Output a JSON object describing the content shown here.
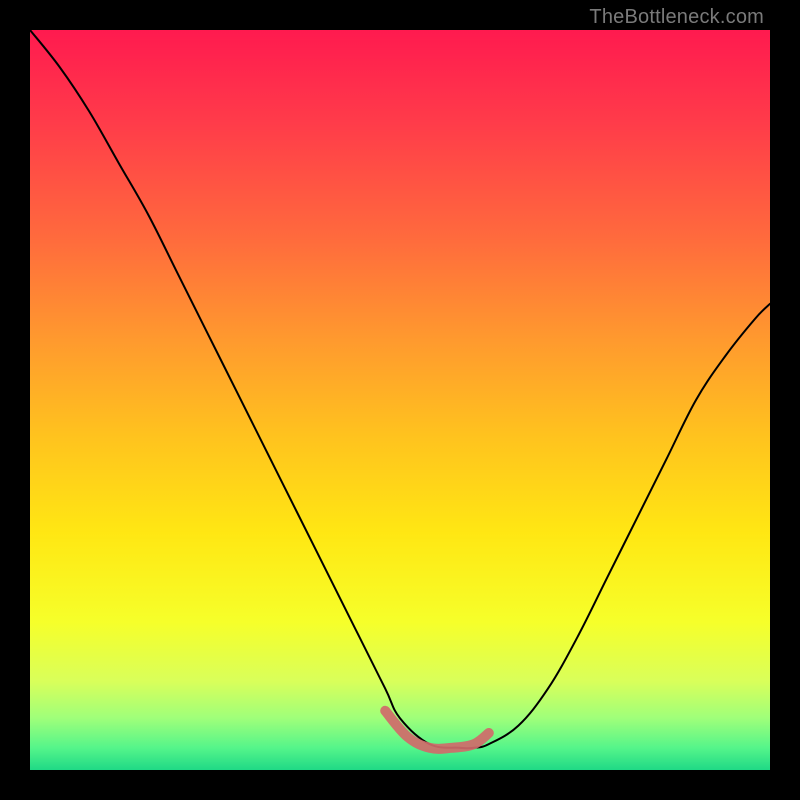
{
  "watermark": "TheBottleneck.com",
  "chart_data": {
    "type": "line",
    "title": "",
    "xlabel": "",
    "ylabel": "",
    "xlim": [
      0,
      100
    ],
    "ylim": [
      0,
      100
    ],
    "grid": false,
    "legend": false,
    "gradient_stops": [
      {
        "pos": 0.0,
        "color": "#ff1a4f"
      },
      {
        "pos": 0.12,
        "color": "#ff3a4a"
      },
      {
        "pos": 0.28,
        "color": "#ff6a3d"
      },
      {
        "pos": 0.42,
        "color": "#ff9a2e"
      },
      {
        "pos": 0.55,
        "color": "#ffc31e"
      },
      {
        "pos": 0.68,
        "color": "#ffe713"
      },
      {
        "pos": 0.8,
        "color": "#f6ff2a"
      },
      {
        "pos": 0.88,
        "color": "#d9ff5a"
      },
      {
        "pos": 0.93,
        "color": "#9fff7a"
      },
      {
        "pos": 0.97,
        "color": "#55f58a"
      },
      {
        "pos": 1.0,
        "color": "#1fd986"
      }
    ],
    "series": [
      {
        "name": "bottleneck-curve",
        "color": "#000000",
        "stroke_width": 2,
        "x": [
          0.0,
          4.0,
          8.0,
          12.0,
          16.0,
          20.0,
          24.0,
          28.0,
          32.0,
          36.0,
          40.0,
          44.0,
          48.0,
          50.0,
          54.0,
          58.0,
          60.0,
          62.0,
          66.0,
          70.0,
          74.0,
          78.0,
          82.0,
          86.0,
          90.0,
          94.0,
          98.0,
          100.0
        ],
        "y": [
          100.0,
          95.0,
          89.0,
          82.0,
          75.0,
          67.0,
          59.0,
          51.0,
          43.0,
          35.0,
          27.0,
          19.0,
          11.0,
          7.0,
          3.5,
          3.0,
          3.0,
          3.5,
          6.0,
          11.0,
          18.0,
          26.0,
          34.0,
          42.0,
          50.0,
          56.0,
          61.0,
          63.0
        ]
      },
      {
        "name": "flat-bottom-highlight",
        "color": "#d06a6a",
        "stroke_width": 10,
        "x": [
          48.0,
          51.0,
          54.0,
          57.0,
          60.0,
          62.0
        ],
        "y": [
          8.0,
          4.5,
          3.0,
          3.0,
          3.5,
          5.0
        ]
      }
    ],
    "annotations": []
  }
}
